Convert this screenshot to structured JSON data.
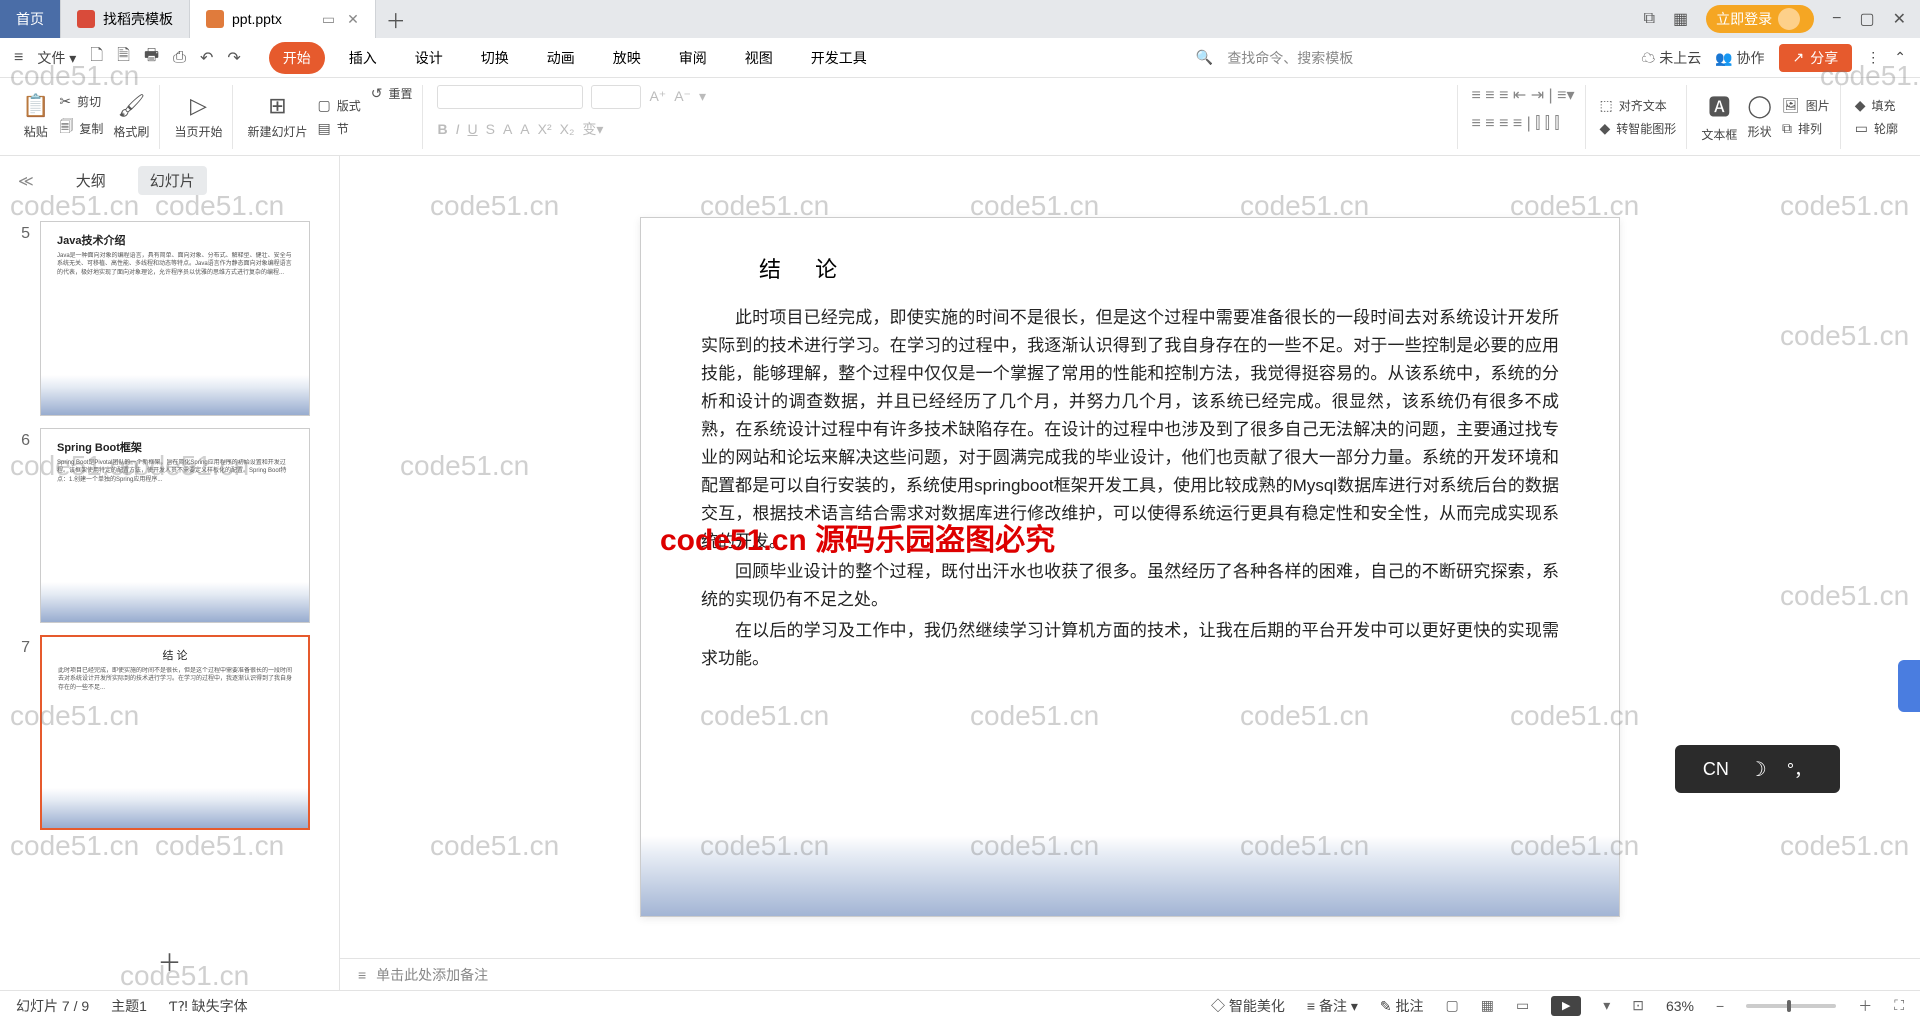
{
  "titlebar": {
    "home": "首页",
    "tabs": [
      {
        "label": "找稻壳模板",
        "iconClass": "template-icon"
      },
      {
        "label": "ppt.pptx",
        "iconClass": "ppt-icon"
      }
    ],
    "login": "立即登录"
  },
  "menu": {
    "file": "文件",
    "items": [
      "开始",
      "插入",
      "设计",
      "切换",
      "动画",
      "放映",
      "审阅",
      "视图",
      "开发工具"
    ],
    "search": "查找命令、搜索模板",
    "cloud": "未上云",
    "collab": "协作",
    "share": "分享"
  },
  "ribbon": {
    "paste": "粘贴",
    "cut": "剪切",
    "copy": "复制",
    "format_painter": "格式刷",
    "from_current": "当页开始",
    "new_slide": "新建幻灯片",
    "layout": "版式",
    "reset": "重置",
    "section": "节",
    "align_text": "对齐文本",
    "to_smart": "转智能图形",
    "text_box": "文本框",
    "shape": "形状",
    "picture": "图片",
    "arrange": "排列",
    "fill": "填充",
    "outline": "轮廓"
  },
  "side": {
    "outline": "大纲",
    "slides": "幻灯片",
    "thumbs": [
      {
        "n": 5,
        "title": "Java技术介绍"
      },
      {
        "n": 6,
        "title": "Spring Boot框架"
      },
      {
        "n": 7,
        "title": "结 论"
      }
    ]
  },
  "slide": {
    "title": "结 论",
    "p1": "此时项目已经完成，即使实施的时间不是很长，但是这个过程中需要准备很长的一段时间去对系统设计开发所实际到的技术进行学习。在学习的过程中，我逐渐认识得到了我自身存在的一些不足。对于一些控制是必要的应用技能，能够理解，整个过程中仅仅是一个掌握了常用的性能和控制方法，我觉得挺容易的。从该系统中，系统的分析和设计的调查数据，并且已经经历了几个月，并努力几个月，该系统已经完成。很显然，该系统仍有很多不成熟，在系统设计过程中有许多技术缺陷存在。在设计的过程中也涉及到了很多自己无法解决的问题，主要通过找专业的网站和论坛来解决这些问题，对于圆满完成我的毕业设计，他们也贡献了很大一部分力量。系统的开发环境和配置都是可以自行安装的，系统使用springboot框架开发工具，使用比较成熟的Mysql数据库进行对系统后台的数据交互，根据技术语言结合需求对数据库进行修改维护，可以使得系统运行更具有稳定性和安全性，从而完成实现系统的开发。",
    "p2": "回顾毕业设计的整个过程，既付出汗水也收获了很多。虽然经历了各种各样的困难，自己的不断研究探索，系统的实现仍有不足之处。",
    "p3": "在以后的学习及工作中，我仍然继续学习计算机方面的技术，让我在后期的平台开发中可以更好更快的实现需求功能。"
  },
  "red_overlay": "code51.cn 源码乐园盗图必究",
  "notes": "单击此处添加备注",
  "status": {
    "slide_pos": "幻灯片 7 / 9",
    "theme": "主题1",
    "missing_font": "缺失字体",
    "beautify": "智能美化",
    "notes": "备注",
    "comments": "批注",
    "zoom": "63%"
  },
  "ime": {
    "lang": "CN"
  },
  "watermark": "code51.cn"
}
